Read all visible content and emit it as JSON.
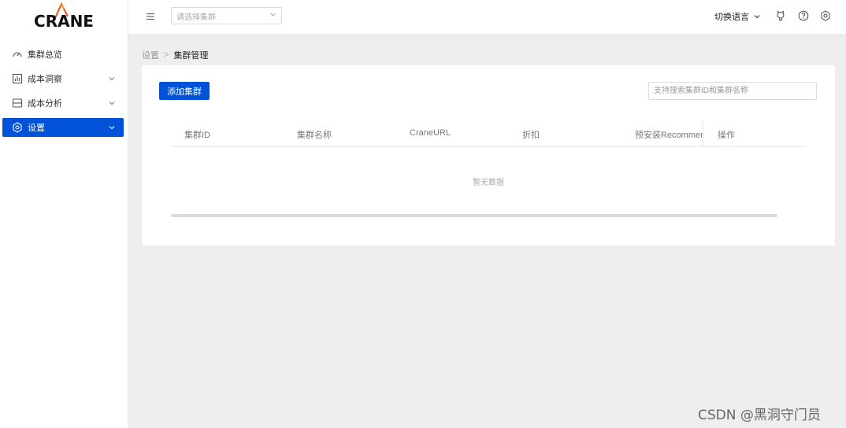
{
  "app": {
    "logo_text": "CRANE"
  },
  "sidebar": {
    "items": [
      {
        "label": "集群总览",
        "icon": "dashboard-icon",
        "expandable": false
      },
      {
        "label": "成本洞察",
        "icon": "chart-icon",
        "expandable": true
      },
      {
        "label": "成本分析",
        "icon": "layers-icon",
        "expandable": true
      },
      {
        "label": "设置",
        "icon": "gear-icon",
        "expandable": true,
        "active": true
      }
    ]
  },
  "header": {
    "cluster_select_placeholder": "请选择集群",
    "language_label": "切换语言"
  },
  "breadcrumb": {
    "root": "设置",
    "separator": ">",
    "current": "集群管理"
  },
  "toolbar": {
    "add_cluster_label": "添加集群",
    "search_placeholder": "支持搜索集群ID和集群名称"
  },
  "table": {
    "columns": [
      "集群ID",
      "集群名称",
      "CraneURL",
      "折扣",
      "预安装Recommend",
      "操作"
    ],
    "empty_text": "暂无数据"
  },
  "watermark": "CSDN @黑洞守门员",
  "colors": {
    "primary": "#0052d9",
    "background": "#eeeeee"
  }
}
